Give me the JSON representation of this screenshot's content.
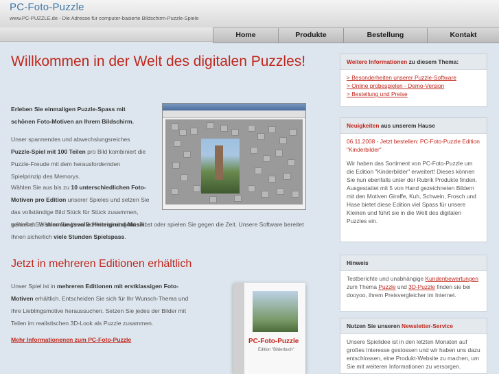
{
  "header": {
    "logo": "PC-Foto-Puzzle",
    "tagline": "www.PC-PUZZLE.de - Die Adresse für computer-basierte Bildschirm-Puzzle-Spiele"
  },
  "nav": [
    {
      "label": "Home"
    },
    {
      "label": "Produkte"
    },
    {
      "label": "Bestellung"
    },
    {
      "label": "Kontakt"
    }
  ],
  "main": {
    "title": "Willkommen in der Welt des digitalen Puzzles!",
    "intro_b": "Erleben Sie einmaligen Puzzle-Spass mit schönen Foto-Motiven an Ihrem Bildschirm.",
    "p2_a": "Unser spannendes und abwechslungsreiches ",
    "p2_b": "Puzzle-Spiel mit 100 Teilen",
    "p2_c": " pro Bild kombiniert die Puzzle-Freude mit dem herausfordernden Spielprinzip des Memorys.",
    "p3_a": "Wählen Sie aus bis zu ",
    "p3_b": "10 unterschiedlichen Foto-Motiven pro Edition",
    "p3_c": " unserer Spieles und setzen Sie das vollständige Bild Stück für Stück zusammen, während Sie ",
    "p3_d": "stimmungsvolle Hintergrund-Musik",
    "p3_e": " genießen. Wählen Sie Ihren Schwierigkeitsgrad selbst oder spielen Sie gegen die Zeit. Unsere Software bereitet Ihnen sicherlich ",
    "p3_f": "viele Stunden Spielspass",
    "p3_g": ".",
    "subtitle": "Jetzt in mehreren Editionen erhältlich",
    "p4_a": "Unser Spiel ist in ",
    "p4_b": "mehreren Editionen mit erstklassigen Foto-Motiven",
    "p4_c": " erhältlich. Entscheiden Sie sich für Ihr Wunsch-Thema und Ihre Lieblingsmotive heraussuchen. Setzen Sie jedes der Bilder mit Teilen im realistischen 3D-Look als Puzzle zusammen.",
    "more_link": "Mehr Informationenen zum PC-Foto-Puzzle",
    "box_title": "PC-Foto-Puzzle",
    "box_sub": "Edition \"Bilderbuch\""
  },
  "sidebar": {
    "info": {
      "head_red": "Weitere Informationen",
      "head_rest": " zu diesem Thema:",
      "links": [
        "> Besonderheiten unserer Puzzle-Software",
        "> Online probespielen - Demo-Version",
        "> Bestellung und Preise"
      ]
    },
    "news": {
      "head_red": "Neuigkeiten",
      "head_rest": " aus unserem Hause",
      "headline": "06.11.2008 - Jetzt bestellen: PC-Foto-Puzzle Edition \"Kinderbilder\"",
      "text1": "Wir haben das Sortiment von PC-Foto-Puzzle um die Edition \"Kinderbilder\" erweitert! Dieses können Sie nun ebenfalls unter der Rubrik Produkte finden.",
      "text2": "Ausgestattet mit 5 von Hand gezeichneten Bildern mit den Motiven Giraffe, Kuh, Schwein, Frosch und Hase bietet diese Edition viel Spass für unsere Kleinen und führt sie in die Welt des digitalen Puzzles ein."
    },
    "hint": {
      "head": "Hinweis",
      "t1": "Testberichte und unabhängige ",
      "l1": "Kundenbewertungen",
      "t2": " zum Thema ",
      "l2": "Puzzle",
      "t3": " und ",
      "l3": "3D-Puzzle",
      "t4": " finden sie bei dooyoo, ihrem Preisvergleicher im Internet."
    },
    "newsletter": {
      "head_a": "Nutzen Sie unseren ",
      "head_red": "Newsletter-Service",
      "text": "Unsere Spielidee ist in den letzten Monaten auf großes Interesse gestossen und wir haben uns dazu entschlossen, eine Produkt-Website zu machen, um Sie mit weiteren Informationen zu versorgen."
    }
  },
  "colors": {
    "accent": "#c0271d",
    "logo": "#3f76a6",
    "background": "#dde6ee"
  }
}
